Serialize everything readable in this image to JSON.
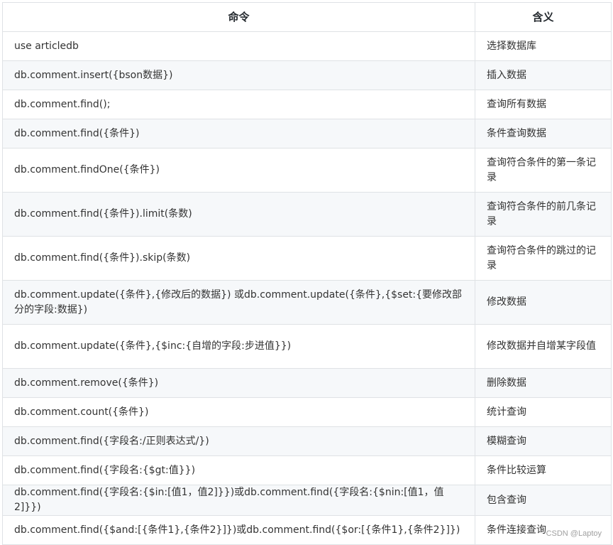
{
  "table": {
    "headers": [
      "命令",
      "含义"
    ],
    "rows": [
      {
        "command": "use articledb",
        "meaning": "选择数据库"
      },
      {
        "command": "db.comment.insert({bson数据})",
        "meaning": "插入数据"
      },
      {
        "command": "db.comment.find();",
        "meaning": "查询所有数据"
      },
      {
        "command": "db.comment.find({条件})",
        "meaning": "条件查询数据"
      },
      {
        "command": "db.comment.findOne({条件})",
        "meaning": "查询符合条件的第一条记录"
      },
      {
        "command": "db.comment.find({条件}).limit(条数)",
        "meaning": "查询符合条件的前几条记录"
      },
      {
        "command": "db.comment.find({条件}).skip(条数)",
        "meaning": "查询符合条件的跳过的记录"
      },
      {
        "command": "db.comment.update({条件},{修改后的数据}) 或db.comment.update({条件},{$set:{要修改部分的字段:数据})",
        "meaning": "修改数据"
      },
      {
        "command": "db.comment.update({条件},{$inc:{自增的字段:步进值}})",
        "meaning": "修改数据并自增某字段值"
      },
      {
        "command": "db.comment.remove({条件})",
        "meaning": "删除数据"
      },
      {
        "command": "db.comment.count({条件})",
        "meaning": "统计查询"
      },
      {
        "command": "db.comment.find({字段名:/正则表达式/})",
        "meaning": "模糊查询"
      },
      {
        "command": "db.comment.find({字段名:{$gt:值}})",
        "meaning": "条件比较运算"
      },
      {
        "command": "db.comment.find({字段名:{$in:[值1，值2]}})或db.comment.find({字段名:{$nin:[值1，值2]}})",
        "meaning": "包含查询"
      },
      {
        "command": "db.comment.find({$and:[{条件1},{条件2}]})或db.comment.find({$or:[{条件1},{条件2}]})",
        "meaning": "条件连接查询"
      }
    ]
  },
  "watermark": "CSDN @Laptoy"
}
